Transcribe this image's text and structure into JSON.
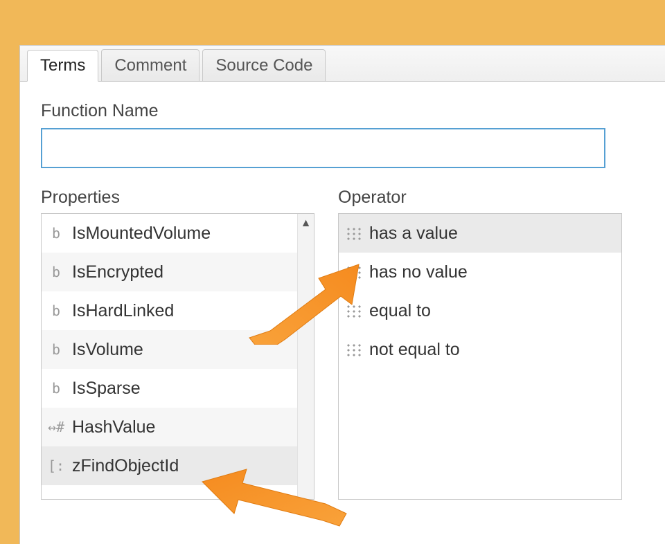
{
  "tabs": {
    "active": "Terms",
    "items": [
      "Terms",
      "Comment",
      "Source Code"
    ]
  },
  "function_name": {
    "label": "Function Name",
    "value": ""
  },
  "properties": {
    "heading": "Properties",
    "items": [
      {
        "icon": "b",
        "label": "IsMountedVolume",
        "alt": false
      },
      {
        "icon": "b",
        "label": "IsEncrypted",
        "alt": true
      },
      {
        "icon": "b",
        "label": "IsHardLinked",
        "alt": false
      },
      {
        "icon": "b",
        "label": "IsVolume",
        "alt": true
      },
      {
        "icon": "b",
        "label": "IsSparse",
        "alt": false
      },
      {
        "icon": "↔#",
        "label": "HashValue",
        "alt": true
      },
      {
        "icon": "[:",
        "label": "zFindObjectId",
        "alt": false,
        "selected": true
      }
    ]
  },
  "operator": {
    "heading": "Operator",
    "items": [
      {
        "label": "has a value",
        "selected": true
      },
      {
        "label": "has no value",
        "selected": false
      },
      {
        "label": "equal to",
        "selected": false
      },
      {
        "label": "not equal to",
        "selected": false
      }
    ]
  },
  "annotations": {
    "arrow1": "points from zFindObjectId toward Operator list",
    "arrow2": "points from zFindObjectId label leftward"
  }
}
